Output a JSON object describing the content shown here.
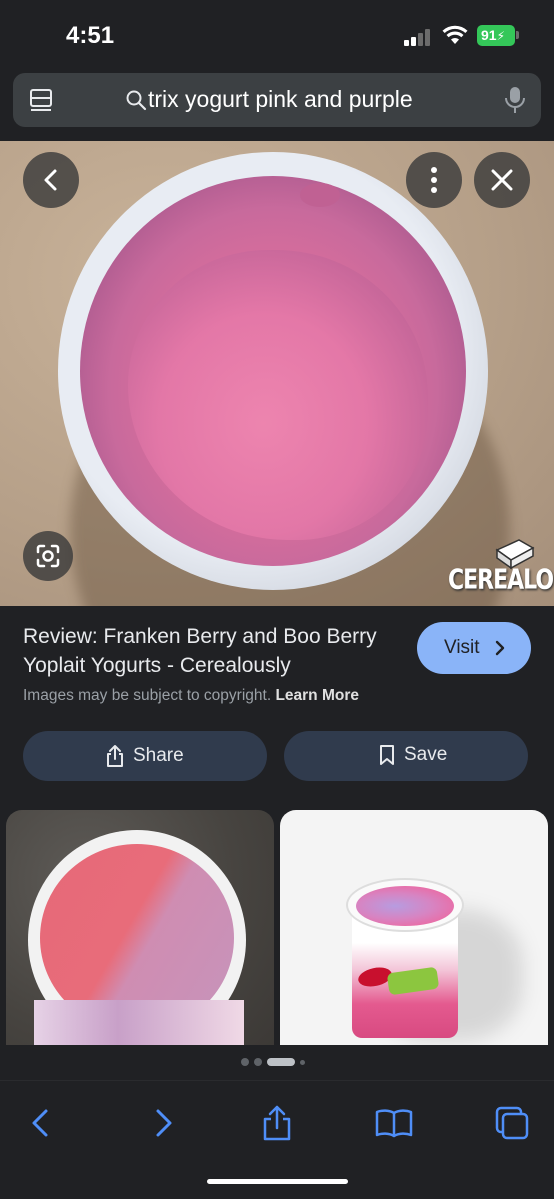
{
  "status_bar": {
    "time": "4:51",
    "battery": "91"
  },
  "search": {
    "query": "trix yogurt pink and purple"
  },
  "image_viewer": {
    "watermark": "CEREALOUSLY"
  },
  "result": {
    "title": "Review: Franken Berry and Boo Berry Yoplait Yogurts - Cerealously",
    "visit_label": "Visit",
    "copyright_text": "Images may be subject to copyright.",
    "learn_more_label": "Learn More"
  },
  "actions": {
    "share_label": "Share",
    "save_label": "Save"
  },
  "icons": {
    "back": "chevron-left-icon",
    "more": "more-vertical-icon",
    "close": "close-icon",
    "lens": "lens-icon",
    "tabs": "tabs-icon",
    "search": "search-icon",
    "mic": "mic-icon"
  },
  "colors": {
    "accent": "#8ab4f8",
    "battery": "#34c759",
    "pill_bg": "#303b4d",
    "background": "#202124"
  }
}
